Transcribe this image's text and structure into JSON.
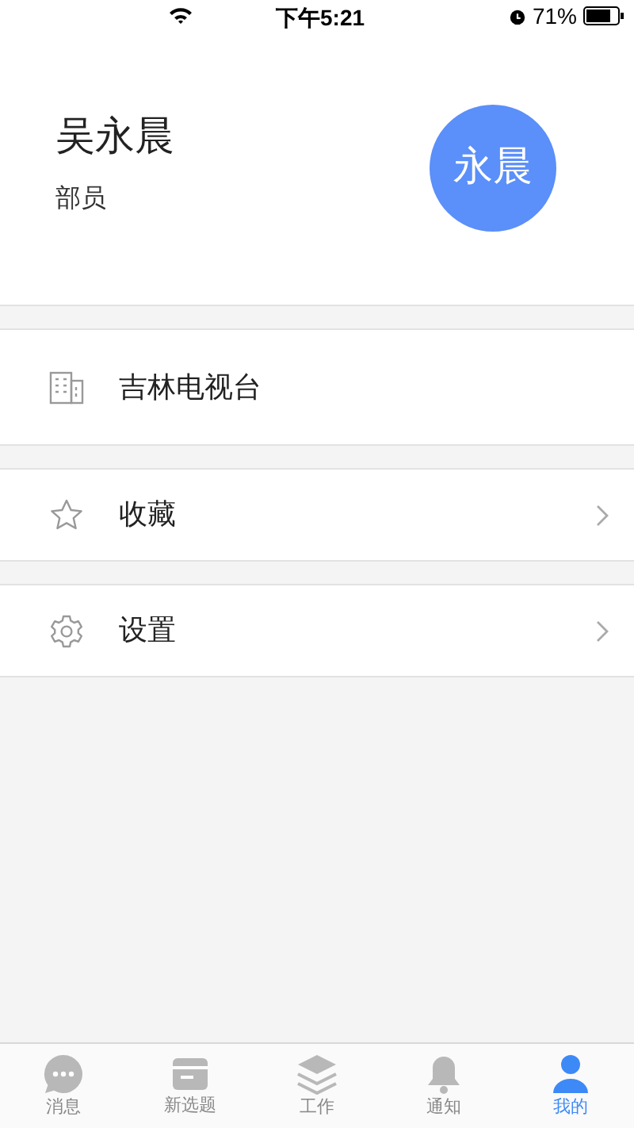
{
  "status_bar": {
    "time": "下午5:21",
    "battery": "71%"
  },
  "profile": {
    "name": "吴永晨",
    "role": "部员",
    "avatar_text": "永晨"
  },
  "menu": [
    {
      "kind": "building",
      "label": "吉林电视台",
      "chevron": false
    },
    {
      "kind": "star",
      "label": "收藏",
      "chevron": true
    },
    {
      "kind": "gear",
      "label": "设置",
      "chevron": true
    }
  ],
  "tab_bar": [
    {
      "kind": "chat",
      "label": "消息",
      "selected": false
    },
    {
      "kind": "card",
      "label": "新选题",
      "selected": false
    },
    {
      "kind": "layers",
      "label": "工作",
      "selected": false
    },
    {
      "kind": "bell",
      "label": "通知",
      "selected": false
    },
    {
      "kind": "person",
      "label": "我的",
      "selected": true
    }
  ]
}
